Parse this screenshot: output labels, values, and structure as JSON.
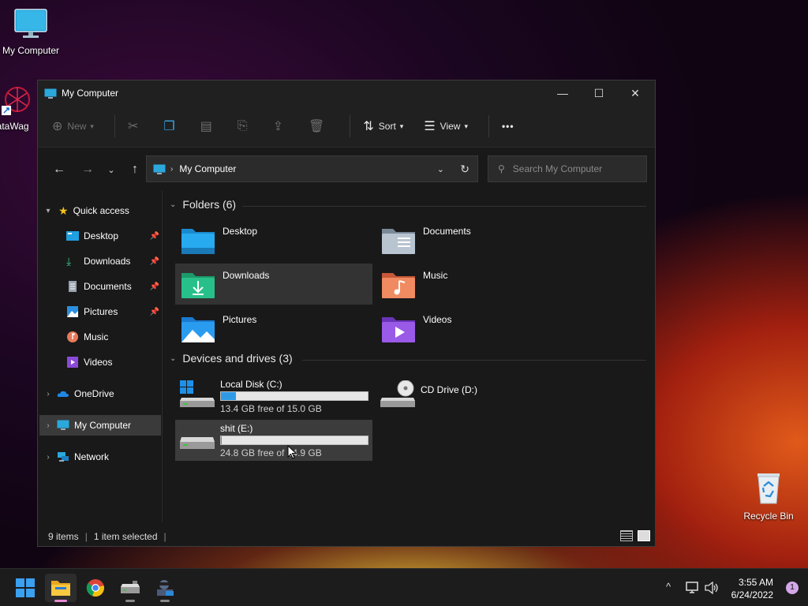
{
  "desktop": {
    "icons": [
      {
        "label": "My Computer",
        "icon": "monitor-icon"
      },
      {
        "label": "DataWag",
        "icon": "datawag-app-icon"
      },
      {
        "label": "Recycle Bin",
        "icon": "recycle-bin-icon"
      }
    ]
  },
  "window": {
    "title": "My Computer",
    "controls": {
      "minimize": "—",
      "maximize": "☐",
      "close": "✕"
    },
    "toolbar": {
      "new_label": "New",
      "sort_label": "Sort",
      "view_label": "View",
      "more_label": "•••"
    },
    "address": {
      "path_label": "My Computer"
    },
    "search": {
      "placeholder": "Search My Computer"
    },
    "sidebar": {
      "quick_access_label": "Quick access",
      "items": [
        {
          "label": "Desktop",
          "pinned": true
        },
        {
          "label": "Downloads",
          "pinned": true
        },
        {
          "label": "Documents",
          "pinned": true
        },
        {
          "label": "Pictures",
          "pinned": true
        },
        {
          "label": "Music",
          "pinned": false
        },
        {
          "label": "Videos",
          "pinned": false
        }
      ],
      "onedrive_label": "OneDrive",
      "mycomputer_label": "My Computer",
      "network_label": "Network"
    },
    "folders": {
      "header": "Folders (6)",
      "items": [
        {
          "label": "Desktop"
        },
        {
          "label": "Documents"
        },
        {
          "label": "Downloads"
        },
        {
          "label": "Music"
        },
        {
          "label": "Pictures"
        },
        {
          "label": "Videos"
        }
      ]
    },
    "drives": {
      "header": "Devices and drives (3)",
      "items": [
        {
          "label": "Local Disk (C:)",
          "free": "13.4 GB free of 15.0 GB",
          "used_fraction": 0.1
        },
        {
          "label": "CD Drive (D:)"
        },
        {
          "label": "shit (E:)",
          "free": "24.8 GB free of 24.9 GB",
          "used_fraction": 0.005
        }
      ]
    },
    "status": {
      "items_count": "9 items",
      "selected": "1 item selected"
    }
  },
  "taskbar": {
    "time": "3:55 AM",
    "date": "6/24/2022",
    "notification_count": "1",
    "tray_chevron": "^"
  },
  "colors": {
    "accent_blue": "#2e9ae6",
    "window_bg": "#191919",
    "taskbar_bg": "#1c1c1c"
  }
}
